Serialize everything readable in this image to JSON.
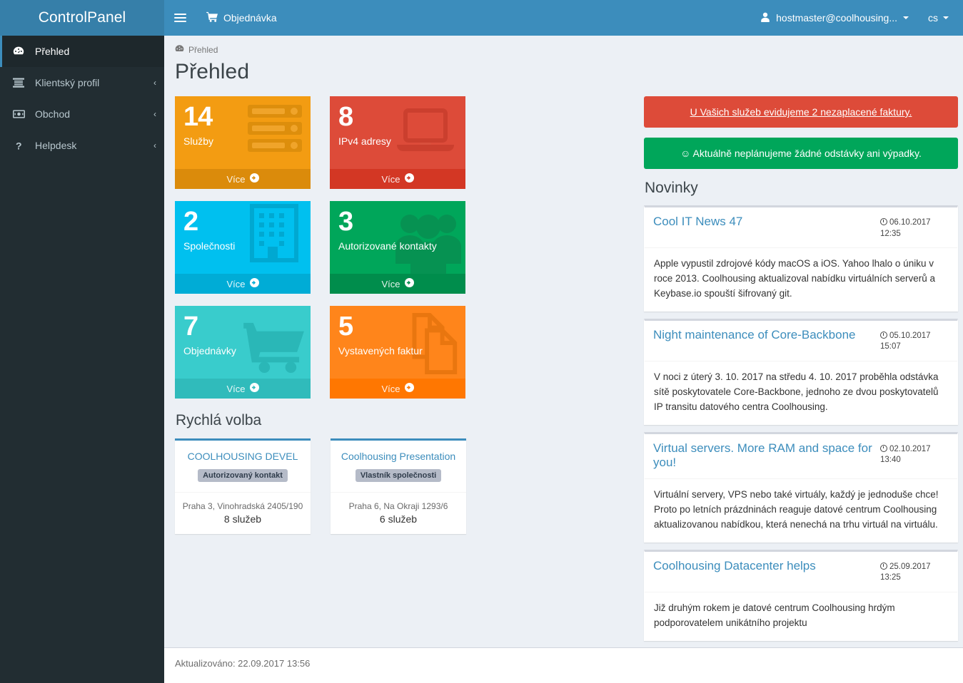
{
  "header": {
    "logo": "ControlPanel",
    "toggle_icon": "hamburger-icon",
    "order_label": "Objednávka",
    "order_icon": "cart-icon",
    "user_label": "hostmaster@coolhousing...",
    "user_icon": "user-icon",
    "lang_label": "cs"
  },
  "sidebar": {
    "items": [
      {
        "label": "Přehled",
        "icon": "dashboard-icon",
        "active": true,
        "arrow": ""
      },
      {
        "label": "Klientský profil",
        "icon": "list-icon",
        "active": false,
        "arrow": "‹"
      },
      {
        "label": "Obchod",
        "icon": "money-icon",
        "active": false,
        "arrow": "‹"
      },
      {
        "label": "Helpdesk",
        "icon": "question-icon",
        "active": false,
        "arrow": "‹"
      }
    ]
  },
  "content": {
    "breadcrumb": "Přehled",
    "breadcrumb_icon": "dashboard-icon",
    "page_title": "Přehled",
    "more_label": "Více"
  },
  "boxes": [
    {
      "value": "14",
      "label": "Služby",
      "color_class": "bg-yellow",
      "icon": "server-icon",
      "accent": "#f39c12"
    },
    {
      "value": "8",
      "label": "IPv4 adresy",
      "color_class": "bg-red",
      "icon": "laptop-icon",
      "accent": "#dd4b39"
    },
    {
      "value": "2",
      "label": "Společnosti",
      "color_class": "bg-aqua",
      "icon": "building-icon",
      "accent": "#00c0ef"
    },
    {
      "value": "3",
      "label": "Autorizované kontakty",
      "color_class": "bg-green",
      "icon": "users-icon",
      "accent": "#00a65a"
    },
    {
      "value": "7",
      "label": "Objednávky",
      "color_class": "bg-teal",
      "icon": "cart-icon",
      "accent": "#39cccc"
    },
    {
      "value": "5",
      "label": "Vystavených faktur",
      "color_class": "bg-orange",
      "icon": "files-icon",
      "accent": "#ff851b"
    }
  ],
  "quick_choice": {
    "title": "Rychlá volba",
    "cards": [
      {
        "name": "COOLHOUSING DEVEL",
        "badge": "Autorizovaný kontakt",
        "address": "Praha 3, Vinohradská 2405/190",
        "services": "8 služeb"
      },
      {
        "name": "Coolhousing Presentation",
        "badge": "Vlastník společnosti",
        "address": "Praha 6, Na Okraji 1293/6",
        "services": "6 služeb"
      }
    ]
  },
  "alerts": [
    {
      "type": "danger",
      "text": "U Vašich služeb evidujeme 2 nezaplacené faktury.",
      "color": "#dd4b39"
    },
    {
      "type": "success",
      "text": "☺ Aktuálně neplánujeme žádné odstávky ani výpadky.",
      "color": "#00a65a"
    }
  ],
  "news": {
    "title": "Novinky",
    "items": [
      {
        "headline": "Cool IT News 47",
        "date": "06.10.2017",
        "time": "12:35",
        "body": "Apple vypustil zdrojové kódy macOS a iOS. Yahoo lhalo o úniku v roce 2013. Coolhousing aktualizoval nabídku virtuálních serverů a Keybase.io spouští šifrovaný git."
      },
      {
        "headline": "Night maintenance of Core-Backbone",
        "date": "05.10.2017",
        "time": "15:07",
        "body": "V noci z úterý 3. 10. 2017 na středu 4. 10. 2017 proběhla odstávka sítě poskytovatele Core-Backbone, jednoho ze dvou poskytovatelů IP transitu datového centra Coolhousing."
      },
      {
        "headline": "Virtual servers. More RAM and space for you!",
        "date": "02.10.2017",
        "time": "13:40",
        "body": "Virtuální servery, VPS nebo také virtuály, každý je jednoduše chce! Proto po letních prázdninách reaguje datové centrum Coolhousing aktualizovanou nabídkou, která nenechá na trhu virtuál na virtuálu."
      },
      {
        "headline": "Coolhousing Datacenter helps",
        "date": "25.09.2017",
        "time": "13:25",
        "body": "Již druhým rokem je datové centrum Coolhousing hrdým podporovatelem unikátního projektu"
      }
    ]
  },
  "footer": {
    "updated": "Aktualizováno: 22.09.2017 13:56"
  }
}
